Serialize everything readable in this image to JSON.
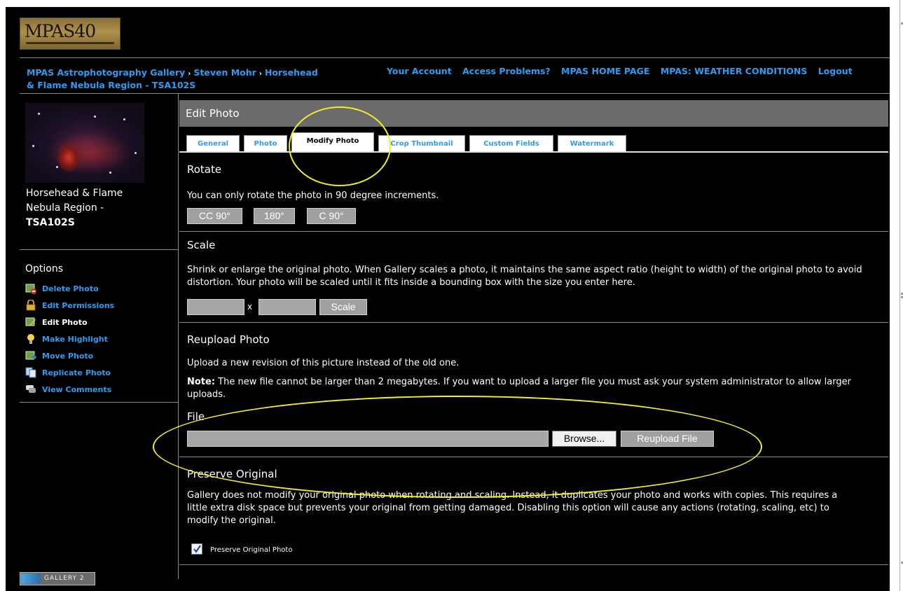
{
  "header": {
    "logo_alt": "MPAS40",
    "breadcrumb": [
      "MPAS Astrophotography Gallery",
      "Steven Mohr",
      "Horsehead",
      "& Flame Nebula Region - TSA102S"
    ],
    "breadcrumb_sep": "›",
    "top_links": [
      "Your Account",
      "Access Problems?",
      "MPAS HOME PAGE",
      "MPAS: WEATHER CONDITIONS",
      "Logout"
    ]
  },
  "sidebar": {
    "photo_title_lines": [
      "Horsehead & Flame",
      "Nebula Region -",
      "TSA102S"
    ],
    "options_title": "Options",
    "options": [
      {
        "label": "Delete Photo",
        "icon": "delete-photo-icon"
      },
      {
        "label": "Edit Permissions",
        "icon": "lock-icon"
      },
      {
        "label": "Edit Photo",
        "icon": "edit-icon"
      },
      {
        "label": "Make Highlight",
        "icon": "lightbulb-icon"
      },
      {
        "label": "Move Photo",
        "icon": "move-icon"
      },
      {
        "label": "Replicate Photo",
        "icon": "copy-icon"
      },
      {
        "label": "View Comments",
        "icon": "comments-icon"
      }
    ],
    "badge": "GALLERY 2"
  },
  "main": {
    "header": "Edit Photo",
    "tabs": [
      "General",
      "Photo",
      "Modify Photo",
      "Crop Thumbnail",
      "Custom Fields",
      "Watermark"
    ],
    "active_tab": "Modify Photo",
    "rotate": {
      "title": "Rotate",
      "text": "You can only rotate the photo in 90 degree increments.",
      "buttons": [
        "CC 90°",
        "180°",
        "C 90°"
      ]
    },
    "scale": {
      "title": "Scale",
      "text": "Shrink or enlarge the original photo. When Gallery scales a photo, it maintains the same aspect ratio (height to width) of the original photo to avoid distortion. Your photo will be scaled until it fits inside a bounding box with the size you enter here.",
      "separator": "x",
      "width_value": "",
      "height_value": "",
      "button": "Scale"
    },
    "reupload": {
      "title": "Reupload Photo",
      "text": "Upload a new revision of this picture instead of the old one.",
      "note_label": "Note:",
      "note_text": " The new file cannot be larger than 2 megabytes. If you want to upload a larger file you must ask your system administrator to allow larger uploads.",
      "file_label": "File",
      "file_value": "",
      "browse_button": "Browse...",
      "reupload_button": "Reupload File"
    },
    "preserve": {
      "title": "Preserve Original",
      "text": "Gallery does not modify your original photo when rotating and scaling. Instead, it duplicates your photo and works with copies. This requires a little extra disk space but prevents your original from getting damaged. Disabling this option will cause any actions (rotating, scaling, etc) to modify the original.",
      "checkbox_label": "Preserve Original Photo",
      "checked": true
    }
  },
  "colors": {
    "link": "#2e9cf0",
    "background": "#000000",
    "header_bar": "#6b6b6b",
    "annotation": "#f2ee2b"
  }
}
